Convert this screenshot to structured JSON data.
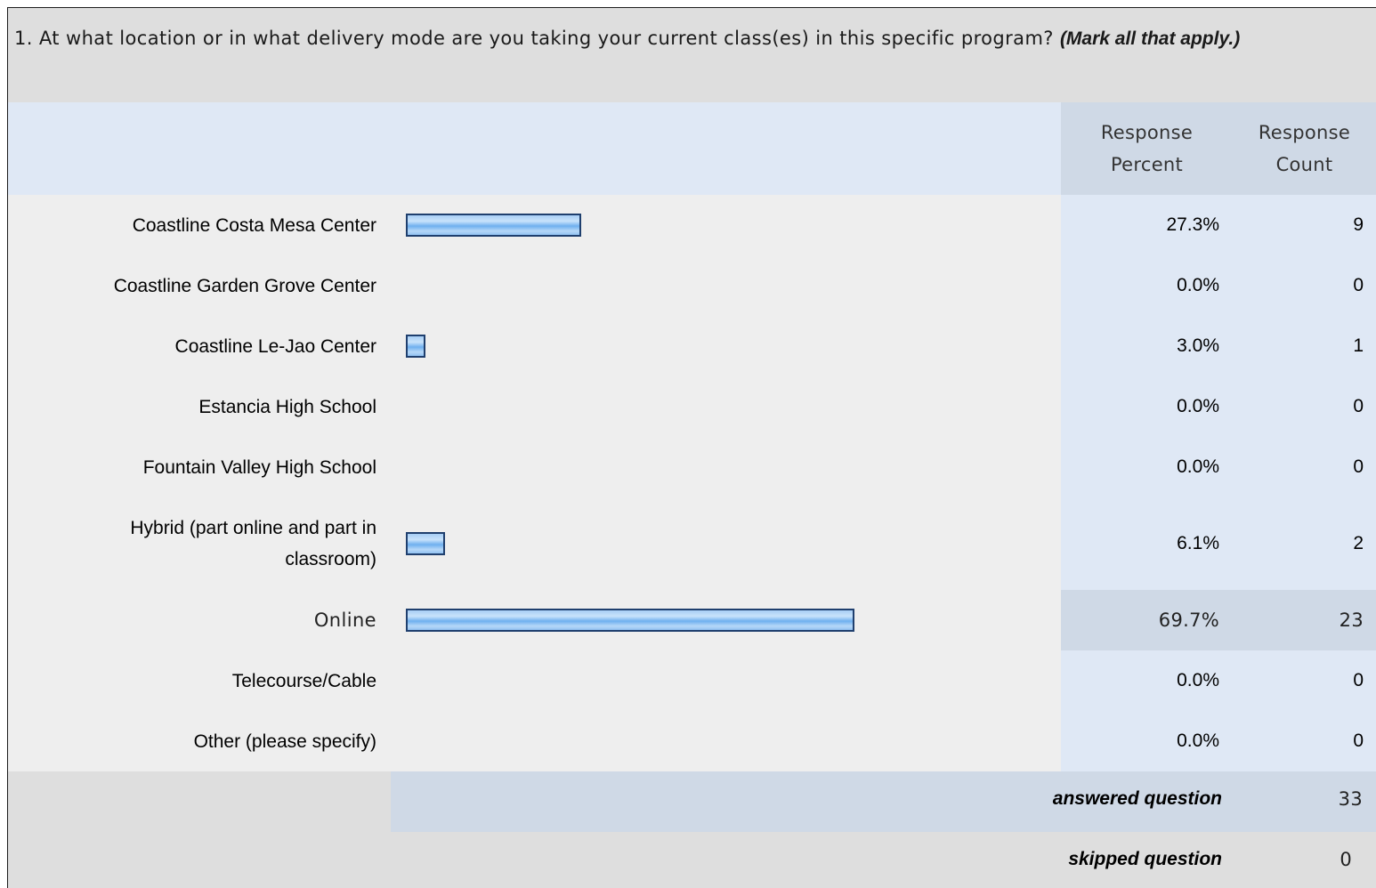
{
  "question": {
    "text": "1. At what location or in what delivery mode are you taking your current class(es) in this specific program?",
    "note": "(Mark all that apply.)"
  },
  "headers": {
    "percent": [
      "Response",
      "Percent"
    ],
    "count": [
      "Response",
      "Count"
    ]
  },
  "chart_data": {
    "type": "bar",
    "orientation": "horizontal",
    "title": "1. At what location or in what delivery mode are you taking your current class(es) in this specific program? (Mark all that apply.)",
    "categories": [
      "Coastline Costa Mesa Center",
      "Coastline Garden Grove Center",
      "Coastline Le-Jao Center",
      "Estancia High School",
      "Fountain Valley High School",
      "Hybrid (part online and part in classroom)",
      "Online",
      "Telecourse/Cable",
      "Other (please specify)"
    ],
    "label_lines": [
      [
        "Coastline Costa Mesa Center"
      ],
      [
        "Coastline Garden Grove Center"
      ],
      [
        "Coastline Le-Jao Center"
      ],
      [
        "Estancia High School"
      ],
      [
        "Fountain Valley High School"
      ],
      [
        "Hybrid (part online and part in",
        "classroom)"
      ],
      [
        "Online"
      ],
      [
        "Telecourse/Cable"
      ],
      [
        "Other (please specify)"
      ]
    ],
    "percent_values": [
      27.3,
      0.0,
      3.0,
      0.0,
      0.0,
      6.1,
      69.7,
      0.0,
      0.0
    ],
    "percent_labels": [
      "27.3%",
      "0.0%",
      "3.0%",
      "0.0%",
      "0.0%",
      "6.1%",
      "69.7%",
      "0.0%",
      "0.0%"
    ],
    "counts": [
      "9",
      "0",
      "1",
      "0",
      "0",
      "2",
      "23",
      "0",
      "0"
    ],
    "highlighted_row": 6,
    "bar_color": "#8ec1f1",
    "bar_border": "#1f3f6e"
  },
  "footer": {
    "answered_label": "answered question",
    "answered_value": "33",
    "skipped_label": "skipped question",
    "skipped_value": "0"
  }
}
